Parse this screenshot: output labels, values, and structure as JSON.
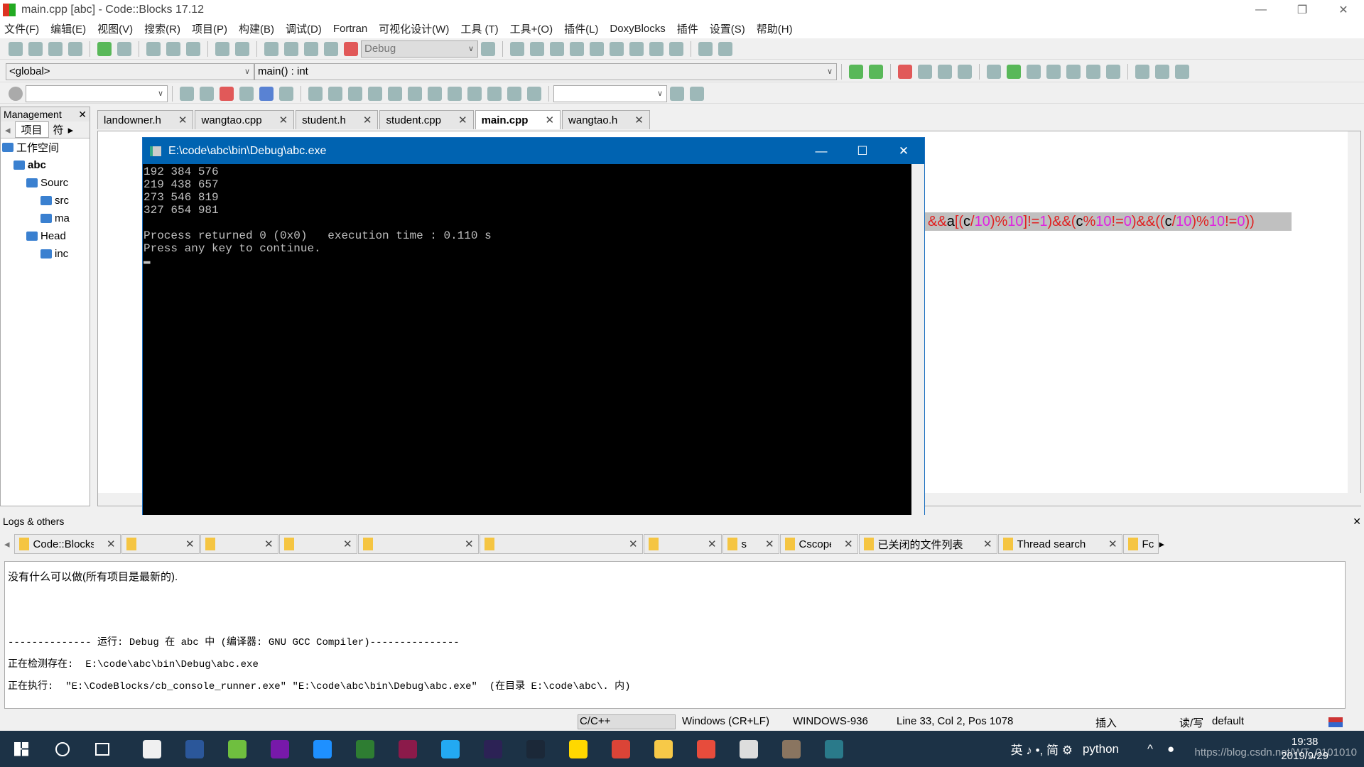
{
  "window": {
    "title": "main.cpp [abc] - Code::Blocks 17.12",
    "minimize": "—",
    "restore": "❐",
    "close": "✕"
  },
  "menu": [
    "文件(F)",
    "编辑(E)",
    "视图(V)",
    "搜索(R)",
    "项目(P)",
    "构建(B)",
    "调试(D)",
    "Fortran",
    "可视化设计(W)",
    "工具 (T)",
    "工具+(O)",
    "插件(L)",
    "DoxyBlocks",
    "插件",
    "设置(S)",
    "帮助(H)"
  ],
  "toolbar": {
    "build_target": "Debug",
    "scope": "<global>",
    "function": "main() : int",
    "search_value": ""
  },
  "management": {
    "title": "Management",
    "close": "✕",
    "tabs": [
      "项目",
      "符"
    ],
    "tree": [
      "工作空间",
      "abc",
      "Sourc",
      "src",
      "ma",
      "Head",
      "inc"
    ]
  },
  "editor": {
    "tabs": [
      "landowner.h",
      "wangtao.cpp",
      "student.h",
      "student.cpp",
      "main.cpp",
      "wangtao.h"
    ],
    "active_tab": "main.cpp",
    "code_line": [
      [
        "&&",
        "#e02020"
      ],
      [
        "a",
        "#000"
      ],
      [
        "[(",
        "#e02020"
      ],
      [
        "c",
        "#000"
      ],
      [
        "/",
        "#e02020"
      ],
      [
        "10",
        "#e020e0"
      ],
      [
        ")%",
        "#e02020"
      ],
      [
        "10",
        "#e020e0"
      ],
      [
        "]!=",
        "#e02020"
      ],
      [
        "1",
        "#e020e0"
      ],
      [
        ")&&(",
        "#e02020"
      ],
      [
        "c",
        "#000"
      ],
      [
        "%",
        "#e02020"
      ],
      [
        "10",
        "#e020e0"
      ],
      [
        "!=",
        "#e02020"
      ],
      [
        "0",
        "#e020e0"
      ],
      [
        ")&&((",
        "#e02020"
      ],
      [
        "c",
        "#000"
      ],
      [
        "/",
        "#e02020"
      ],
      [
        "10",
        "#e020e0"
      ],
      [
        ")%",
        "#e02020"
      ],
      [
        "10",
        "#e020e0"
      ],
      [
        "!=",
        "#e02020"
      ],
      [
        "0",
        "#e020e0"
      ],
      [
        "))",
        "#e02020"
      ]
    ]
  },
  "console": {
    "title": "E:\\code\\abc\\bin\\Debug\\abc.exe",
    "output": "192 384 576\n219 438 657\n273 546 819\n327 654 981\n\nProcess returned 0 (0x0)   execution time : 0.110 s\nPress any key to continue.\n▬"
  },
  "logs": {
    "title": "Logs & others",
    "close": "✕",
    "tabs": [
      "Code::Blocks",
      "",
      "",
      "",
      "",
      "",
      "",
      "s",
      "Cscope",
      "已关闭的文件列表",
      "Thread search",
      "Fc"
    ],
    "lines": [
      "没有什么可以做(所有项目是最新的).",
      "",
      "-------------- 运行: Debug 在 abc 中 (编译器: GNU GCC Compiler)---------------",
      "正在检测存在:  E:\\code\\abc\\bin\\Debug\\abc.exe",
      "正在执行:  \"E:\\CodeBlocks/cb_console_runner.exe\" \"E:\\code\\abc\\bin\\Debug\\abc.exe\"  (在目录 E:\\code\\abc\\. 内)"
    ]
  },
  "status": {
    "language": "C/C++",
    "eol": "Windows (CR+LF)",
    "encoding": "WINDOWS-936",
    "position": "Line 33, Col 2, Pos 1078",
    "mode": "插入",
    "access": "读/写",
    "theme": "default"
  },
  "taskbar": {
    "apps": [
      "store",
      "visio",
      "qq-browser",
      "onenote",
      "kugou",
      "globe",
      "winrar",
      "vscode",
      "eclipse",
      "steam",
      "sticky-notes",
      "chrome",
      "file-explorer",
      "office",
      "netease-music",
      "game",
      "console"
    ],
    "tray_text": "英 ♪ •, 简 ⚙",
    "python": "python",
    "time": "19:38",
    "date": "2019/9/29",
    "watermark": "https://blog.csdn.net/WT_0101010"
  },
  "colors": {
    "console_title": "#0063b1",
    "taskbar": "#1c3246",
    "highlight": "#c0c0c0"
  }
}
